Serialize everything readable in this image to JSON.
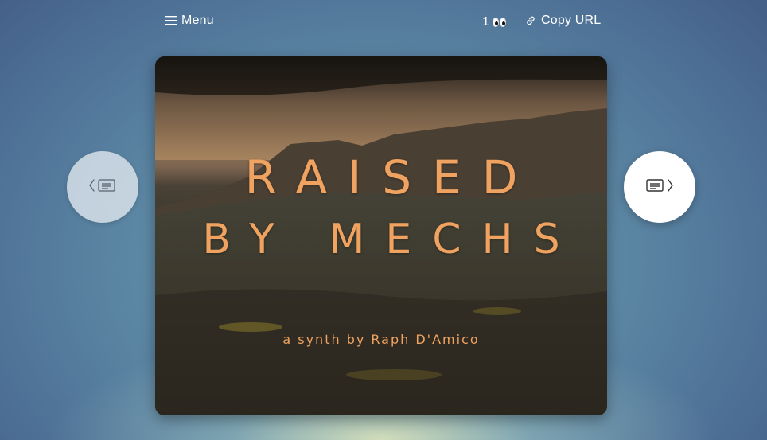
{
  "topbar": {
    "menu_label": "Menu",
    "view_count": "1",
    "copy_url_label": "Copy URL"
  },
  "card": {
    "title_line1": "RAISED",
    "title_line2": "BY MECHS",
    "subtitle": "a synth by Raph D'Amico"
  },
  "icons": {
    "menu": "hamburger-icon",
    "views": "eyes-icon",
    "copy_url": "link-icon",
    "prev": "previous-card-icon",
    "next": "next-card-icon"
  },
  "colors": {
    "title_text": "#f0a360",
    "topbar_text": "#ffffff"
  }
}
